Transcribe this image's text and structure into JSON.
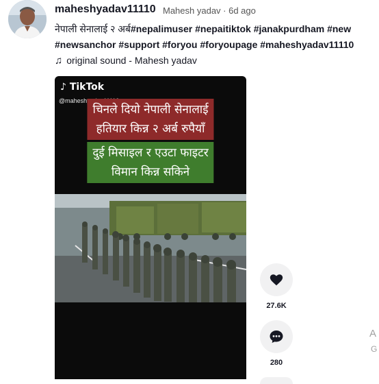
{
  "post": {
    "username": "maheshyadav11110",
    "meta": "Mahesh yadav · 6d ago",
    "caption_text": "नेपाली सेनालाई २ अर्ब",
    "tags_line1": "#nepalimuser #nepaitiktok #janakpurdham #new",
    "tags_line2": "#newsanchor #support #foryou #foryoupage #maheshyadav11110",
    "sound": "original sound - Mahesh yadav"
  },
  "video": {
    "watermark": "TikTok",
    "watermark_user": "@maheshyadav11110",
    "banner1_line1": "चिनले दियो नेपाली सेनालाई",
    "banner1_line2": "हतियार किन्न २ अर्ब रुपैयाँ",
    "banner2_line1": "दुई मिसाइल र एउटा फाइटर",
    "banner2_line2": "विमान किन्न सकिने"
  },
  "actions": {
    "likes": "27.6K",
    "comments": "280"
  },
  "clipped": {
    "right_a": "A",
    "right_g": "G"
  },
  "icons": [
    "heart-icon",
    "comment-icon",
    "music-note-icon",
    "tiktok-logo-icon"
  ],
  "colors": {
    "red_banner": "#8e2a2a",
    "green_banner": "#3f7d2d",
    "action_bg": "#f1f1f2"
  }
}
